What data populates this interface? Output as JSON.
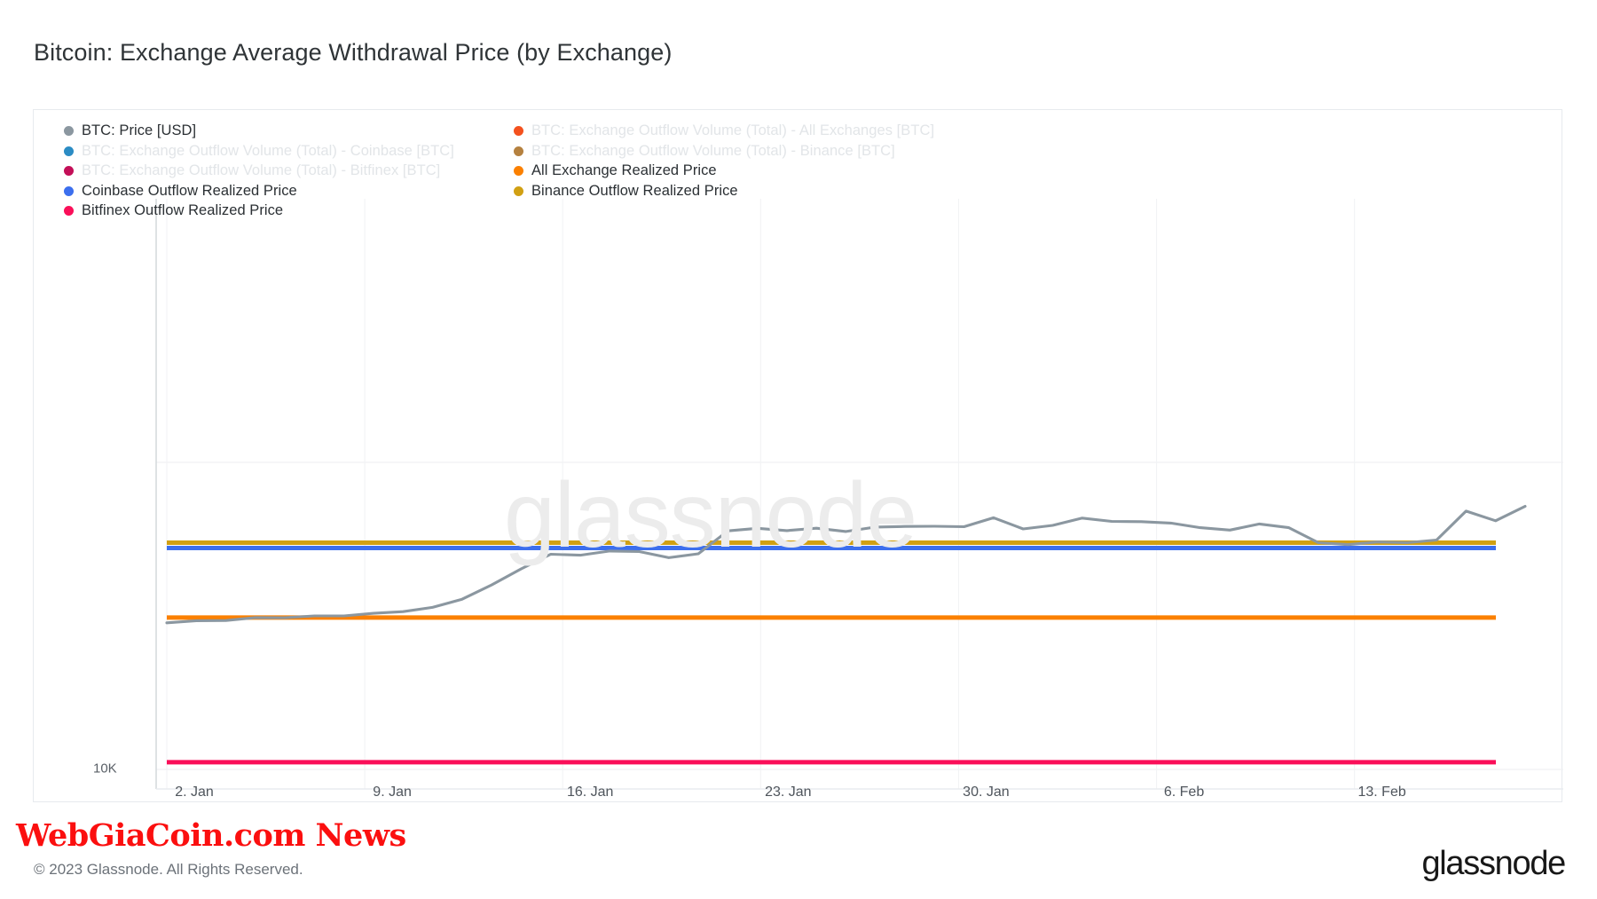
{
  "header": {
    "title": "Bitcoin: Exchange Average Withdrawal Price (by Exchange)"
  },
  "legend": {
    "left": [
      {
        "label": "BTC: Price [USD]",
        "color": "#8b97a0",
        "active": true
      },
      {
        "label": "BTC: Exchange Outflow Volume (Total) - Coinbase [BTC]",
        "color": "#2b8cc4",
        "active": false
      },
      {
        "label": "BTC: Exchange Outflow Volume (Total) - Bitfinex [BTC]",
        "color": "#c30f58",
        "active": false
      },
      {
        "label": "Coinbase Outflow Realized Price",
        "color": "#3c6fee",
        "active": true
      },
      {
        "label": "Bitfinex Outflow Realized Price",
        "color": "#fa0f59",
        "active": true
      }
    ],
    "right": [
      {
        "label": "BTC: Exchange Outflow Volume (Total) - All Exchanges [BTC]",
        "color": "#f4511e",
        "active": false
      },
      {
        "label": "BTC: Exchange Outflow Volume (Total) - Binance [BTC]",
        "color": "#b5813f",
        "active": false
      },
      {
        "label": "All Exchange Realized Price",
        "color": "#fb8000",
        "active": true
      },
      {
        "label": "Binance Outflow Realized Price",
        "color": "#d1a013",
        "active": true
      }
    ]
  },
  "footer": {
    "site_watermark": "WebGiaCoin.com News",
    "copyright": "© 2023 Glassnode. All Rights Reserved.",
    "brand": "glassnode"
  },
  "plot_watermark": "glassnode",
  "chart_data": {
    "type": "line",
    "title": "Bitcoin: Exchange Average Withdrawal Price (by Exchange)",
    "xlabel": "",
    "ylabel": "",
    "y_scale": "log",
    "y_ticks": [
      "10K"
    ],
    "y_tick_values": [
      10000
    ],
    "grid": true,
    "legend_position": "top-left",
    "x_tick_labels": [
      "2. Jan",
      "9. Jan",
      "16. Jan",
      "23. Jan",
      "30. Jan",
      "6. Feb",
      "13. Feb"
    ],
    "x_range": [
      "2023-01-01",
      "2023-02-18"
    ],
    "series": [
      {
        "name": "BTC: Price [USD]",
        "color": "#8b97a0",
        "visible": true,
        "x": [
          "2023-01-01",
          "2023-01-02",
          "2023-01-03",
          "2023-01-04",
          "2023-01-05",
          "2023-01-06",
          "2023-01-07",
          "2023-01-08",
          "2023-01-09",
          "2023-01-10",
          "2023-01-11",
          "2023-01-12",
          "2023-01-13",
          "2023-01-14",
          "2023-01-15",
          "2023-01-16",
          "2023-01-17",
          "2023-01-18",
          "2023-01-19",
          "2023-01-20",
          "2023-01-21",
          "2023-01-22",
          "2023-01-23",
          "2023-01-24",
          "2023-01-25",
          "2023-01-26",
          "2023-01-27",
          "2023-01-28",
          "2023-01-29",
          "2023-01-30",
          "2023-01-31",
          "2023-02-01",
          "2023-02-02",
          "2023-02-03",
          "2023-02-04",
          "2023-02-05",
          "2023-02-06",
          "2023-02-07",
          "2023-02-08",
          "2023-02-09",
          "2023-02-10",
          "2023-02-11",
          "2023-02-12",
          "2023-02-13",
          "2023-02-14",
          "2023-02-15",
          "2023-02-16",
          "2023-02-17"
        ],
        "values": [
          16550,
          16670,
          16680,
          16850,
          16840,
          16950,
          16950,
          17100,
          17200,
          17450,
          17950,
          18850,
          19920,
          20950,
          20880,
          21180,
          21140,
          20700,
          20980,
          22700,
          22900,
          22720,
          22910,
          22650,
          23000,
          23050,
          23060,
          23030,
          23750,
          22850,
          23130,
          23720,
          23450,
          23430,
          23320,
          22950,
          22760,
          23250,
          22950,
          21800,
          21650,
          21850,
          21800,
          22000,
          24300,
          23500,
          24700
        ],
        "marker": "none"
      },
      {
        "name": "Binance Outflow Realized Price",
        "color": "#d1a013",
        "visible": true,
        "type": "horizontal",
        "value": 21800
      },
      {
        "name": "Coinbase Outflow Realized Price",
        "color": "#3c6fee",
        "visible": true,
        "type": "horizontal",
        "value": 21400
      },
      {
        "name": "All Exchange Realized Price",
        "color": "#fb8000",
        "visible": true,
        "type": "horizontal",
        "value": 16850
      },
      {
        "name": "Bitfinex Outflow Realized Price",
        "color": "#fa0f59",
        "visible": true,
        "type": "horizontal",
        "value": 10250
      },
      {
        "name": "BTC: Exchange Outflow Volume (Total) - All Exchanges [BTC]",
        "color": "#f4511e",
        "visible": false
      },
      {
        "name": "BTC: Exchange Outflow Volume (Total) - Coinbase [BTC]",
        "color": "#2b8cc4",
        "visible": false
      },
      {
        "name": "BTC: Exchange Outflow Volume (Total) - Binance [BTC]",
        "color": "#b5813f",
        "visible": false
      },
      {
        "name": "BTC: Exchange Outflow Volume (Total) - Bitfinex [BTC]",
        "color": "#c30f58",
        "visible": false
      }
    ]
  }
}
